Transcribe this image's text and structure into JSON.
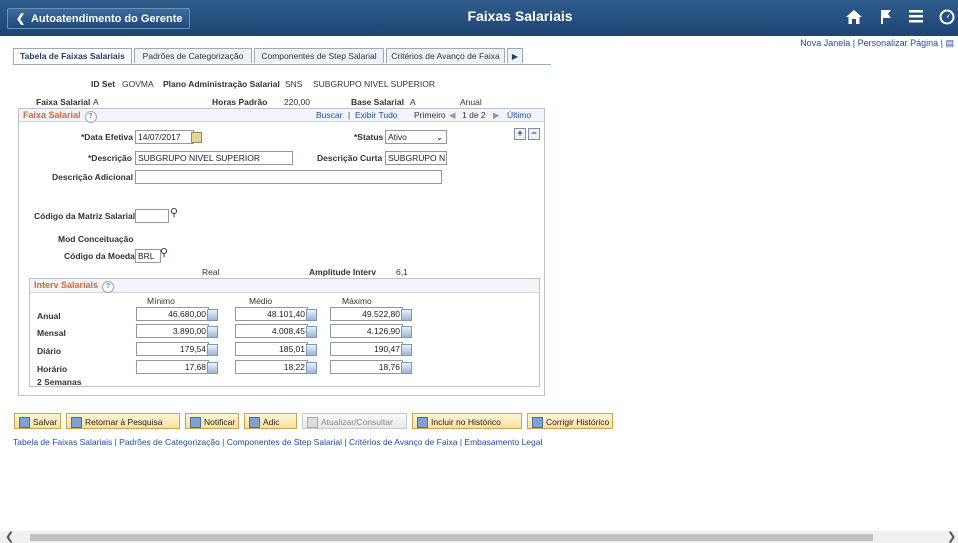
{
  "header": {
    "back_label": "Autoatendimento do Gerente",
    "title": "Faixas Salariais",
    "icons": [
      "home-icon",
      "flag-icon",
      "menu-icon",
      "navbar-icon"
    ]
  },
  "top_links": {
    "new_window": "Nova Janela",
    "personalize": "Personalizar Página"
  },
  "tabs": [
    "Tabela de Faixas Salariais",
    "Padrões de Categorização",
    "Componentes de Step Salarial",
    "Critérios de Avanço de Faixa"
  ],
  "summary": {
    "id_set_label": "ID Set",
    "id_set_value": "GOVMA",
    "plano_label": "Plano Administração Salarial",
    "plano_value": "SNS",
    "plano_desc": "SUBGRUPO NIVEL SUPERIOR",
    "faixa_label": "Faixa Salarial",
    "faixa_value": "A",
    "horas_label": "Horas Padrão",
    "horas_value": "220,00",
    "base_label": "Base Salarial",
    "base_value": "A",
    "base_desc": "Anual"
  },
  "faixa_box": {
    "title": "Faixa Salarial",
    "buscar": "Buscar",
    "exibir_tudo": "Exibir Tudo",
    "primeiro": "Primeiro",
    "paging": "1 de 2",
    "ultimo": "Último",
    "data_efetiva_label": "*Data Efetiva",
    "data_efetiva_value": "14/07/2017",
    "status_label": "*Status",
    "status_value": "Ativo",
    "descricao_label": "*Descrição",
    "descricao_value": "SUBGRUPO NIVEL SUPERIOR",
    "desc_curta_label": "Descrição Curta",
    "desc_curta_value": "SUBGRUPO N",
    "desc_adicional_label": "Descrição Adicional",
    "desc_adicional_value": "",
    "matriz_label": "Código da Matriz Salarial",
    "matriz_value": "",
    "mod_label": "Mod Conceituação",
    "moeda_label": "Código da Moeda",
    "moeda_value": "BRL",
    "moeda_desc": "Real",
    "amplitude_label": "Amplitude Interv",
    "amplitude_value": "6,1"
  },
  "interv": {
    "title": "Interv Salariais",
    "columns": [
      "Mínimo",
      "Médio",
      "Máximo"
    ],
    "rows": [
      {
        "label": "Anual",
        "values": [
          "46.680,00",
          "48.101,40",
          "49.522,80"
        ]
      },
      {
        "label": "Mensal",
        "values": [
          "3.890,00",
          "4.008,45",
          "4.126,90"
        ]
      },
      {
        "label": "Diário",
        "values": [
          "179,54",
          "185,01",
          "190,47"
        ]
      },
      {
        "label": "Horário",
        "values": [
          "17,68",
          "18,22",
          "18,76"
        ]
      }
    ],
    "extra_label": "2 Semanas"
  },
  "toolbar": {
    "salvar": "Salvar",
    "retornar": "Retornar à Pesquisa",
    "notificar": "Notificar",
    "adic": "Adic",
    "atualizar": "Atualizar/Consultar",
    "incluir": "Incluir no Histórico",
    "corrigir": "Corrigir Histórico"
  },
  "bottom_links": "Tabela de Faixas Salariais | Padrões de Categorização | Componentes de Step Salarial | Critérios de Avanço de Faixa | Embasamento Legal"
}
